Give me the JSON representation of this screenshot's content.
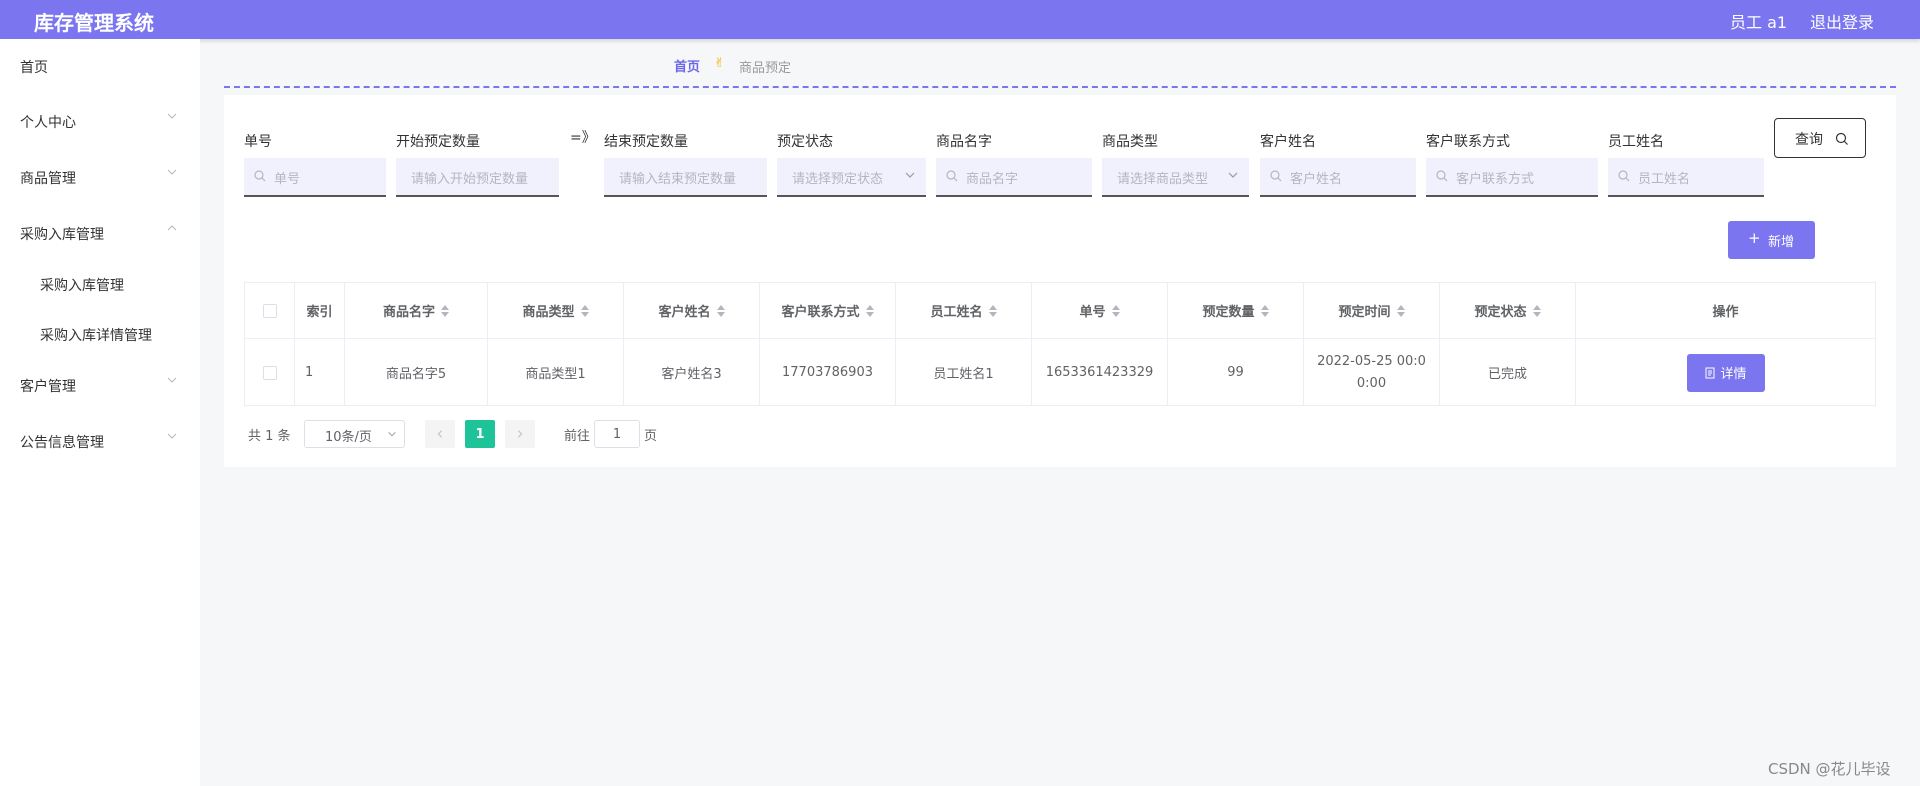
{
  "header": {
    "title": "库存管理系统",
    "user": "员工 a1",
    "logout": "退出登录"
  },
  "sidebar": {
    "items": [
      {
        "label": "首页",
        "chevron": ""
      },
      {
        "label": "个人中心",
        "chevron": "chevron-down-icon"
      },
      {
        "label": "商品管理",
        "chevron": "chevron-down-icon"
      },
      {
        "label": "采购入库管理",
        "chevron": "chevron-up-icon"
      },
      {
        "label": "采购入库管理",
        "chevron": ""
      },
      {
        "label": "采购入库详情管理",
        "chevron": ""
      },
      {
        "label": "客户管理",
        "chevron": "chevron-down-icon"
      },
      {
        "label": "公告信息管理",
        "chevron": "chevron-down-icon"
      }
    ]
  },
  "breadcrumb": {
    "home": "首页",
    "current": "商品预定"
  },
  "filters": {
    "order_no": {
      "label": "单号",
      "placeholder": "单号"
    },
    "start_qty": {
      "label": "开始预定数量",
      "placeholder": "请输入开始预定数量"
    },
    "range_sep": "=》",
    "end_qty": {
      "label": "结束预定数量",
      "placeholder": "请输入结束预定数量"
    },
    "status": {
      "label": "预定状态",
      "placeholder": "请选择预定状态"
    },
    "product_name": {
      "label": "商品名字",
      "placeholder": "商品名字"
    },
    "product_type": {
      "label": "商品类型",
      "placeholder": "请选择商品类型"
    },
    "customer_name": {
      "label": "客户姓名",
      "placeholder": "客户姓名"
    },
    "customer_contact": {
      "label": "客户联系方式",
      "placeholder": "客户联系方式"
    },
    "employee_name": {
      "label": "员工姓名",
      "placeholder": "员工姓名"
    },
    "search_button": "查询"
  },
  "add_button": "新增",
  "table": {
    "columns": [
      "索引",
      "商品名字",
      "商品类型",
      "客户姓名",
      "客户联系方式",
      "员工姓名",
      "单号",
      "预定数量",
      "预定时间",
      "预定状态",
      "操作"
    ],
    "rows": [
      {
        "index": "1",
        "product_name": "商品名字5",
        "product_type": "商品类型1",
        "customer_name": "客户姓名3",
        "customer_contact": "17703786903",
        "employee_name": "员工姓名1",
        "order_no": "1653361423329",
        "quantity": "99",
        "time": "2022-05-25 00:00:00",
        "status": "已完成",
        "action": "详情"
      }
    ]
  },
  "pagination": {
    "total": "共 1 条",
    "page_size": "10条/页",
    "current": "1",
    "goto_prefix": "前往",
    "goto_value": "1",
    "goto_suffix": "页"
  },
  "watermark": "CSDN @花儿毕设",
  "colors": {
    "primary": "#7b76f0",
    "active_page": "#1fc39a"
  }
}
